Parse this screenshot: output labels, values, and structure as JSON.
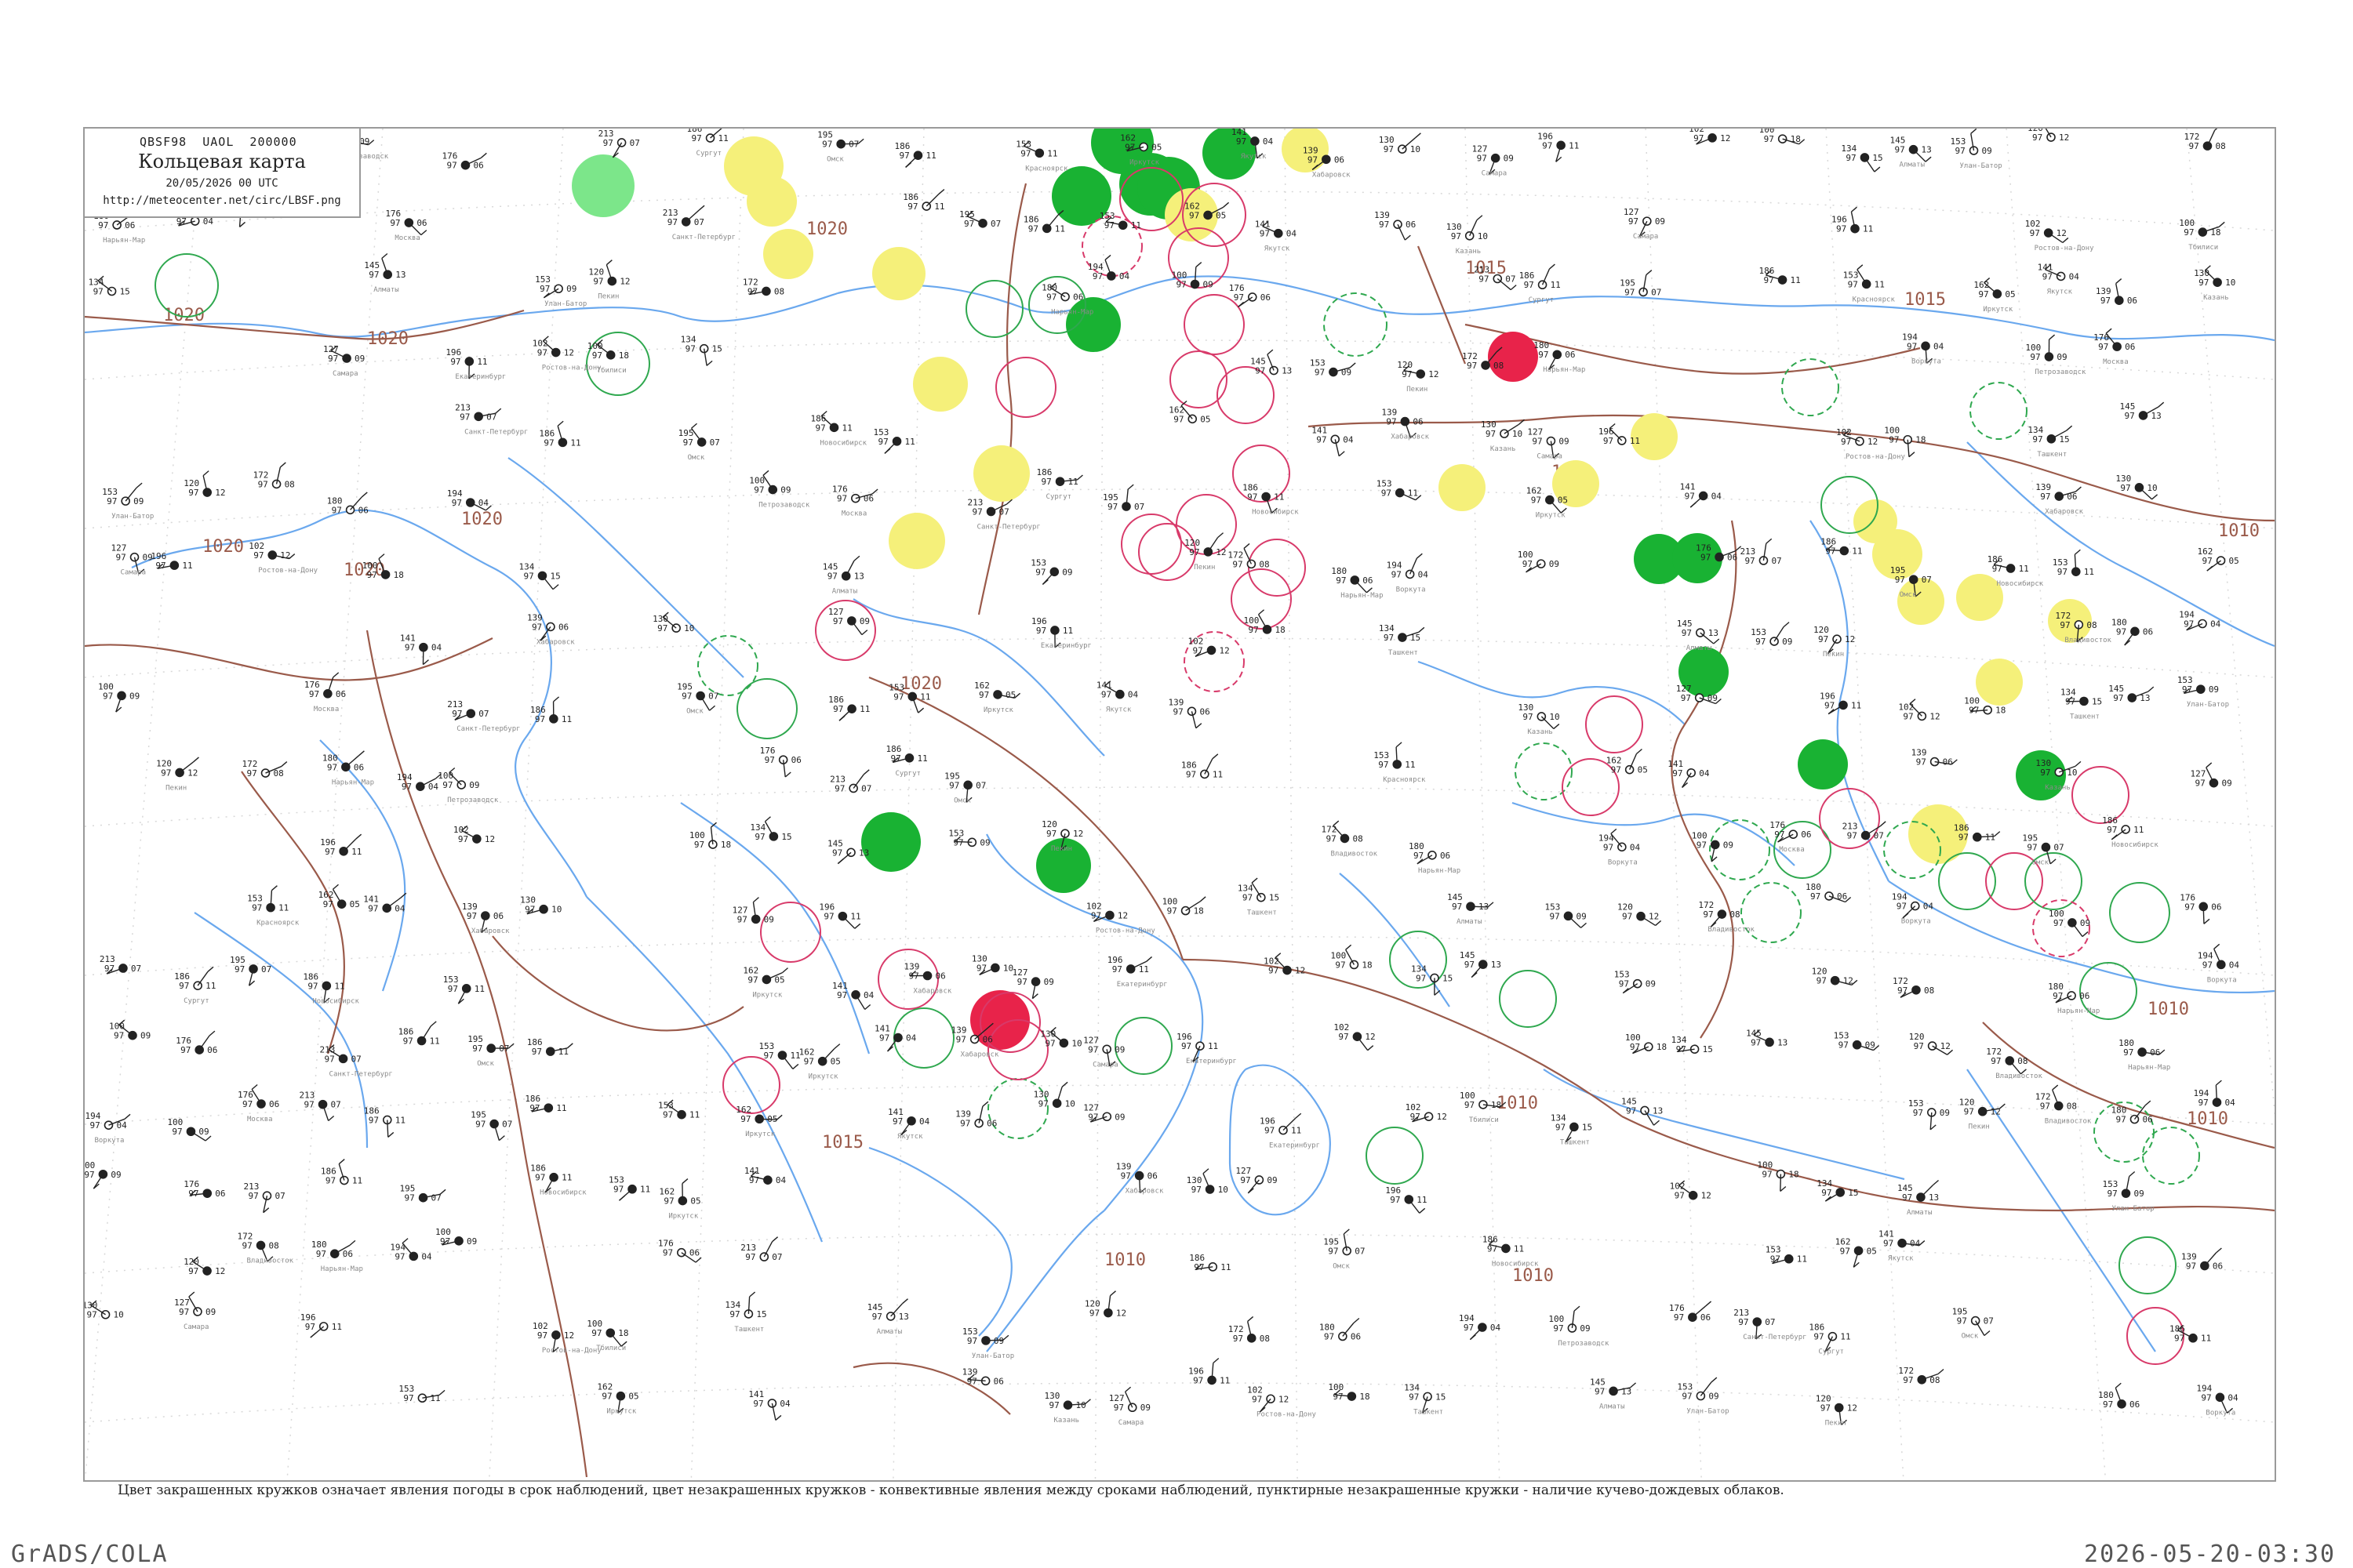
{
  "header": {
    "code": "QBSF98  UAOL  200000",
    "title": "Кольцевая карта",
    "date": "20/05/2026 00 UTC",
    "url": "http://meteocenter.net/circ/LBSF.png"
  },
  "caption": "Цвет закрашенных кружков означает явления погоды в срок наблюдений, цвет незакрашенных кружков - конвективные явления между сроками наблюдений, пунктирные незакрашенные кружки - наличие кучево-дождевых облаков.",
  "footer": {
    "left": "GrADS/COLA",
    "right": "2026-05-20-03:30"
  },
  "colors": {
    "coast": "#6aa8ee",
    "isobar": "#9a5a4a",
    "filled_green": "#19b233",
    "filled_yellow": "#f5f07a",
    "filled_light_green": "#7ce68a",
    "filled_red": "#e8234a",
    "ring_green": "#2fa84f",
    "ring_red": "#d83a6a",
    "station": "#222222"
  },
  "isobar_labels": [
    "1020",
    "1020",
    "1020",
    "1020",
    "1020",
    "1020",
    "1020",
    "1015",
    "1015",
    "1015",
    "1010",
    "1010",
    "1010",
    "1010",
    "1010",
    "1010",
    "1010"
  ],
  "stations": [
    {
      "name": "Нарьян-Мар",
      "t": "180",
      "p": "97",
      "d": "06"
    },
    {
      "name": "Воркута",
      "t": "194",
      "p": "97",
      "d": "04"
    },
    {
      "name": "Петрозаводск",
      "t": "100",
      "p": "97",
      "d": "09"
    },
    {
      "name": "Москва",
      "t": "176",
      "p": "97",
      "d": "06"
    },
    {
      "name": "Санкт-Петербург",
      "t": "213",
      "p": "97",
      "d": "07"
    },
    {
      "name": "Сургут",
      "t": "186",
      "p": "97",
      "d": "11"
    },
    {
      "name": "Омск",
      "t": "195",
      "p": "97",
      "d": "07"
    },
    {
      "name": "Новосибирск",
      "t": "186",
      "p": "97",
      "d": "11"
    },
    {
      "name": "Красноярск",
      "t": "153",
      "p": "97",
      "d": "11"
    },
    {
      "name": "Иркутск",
      "t": "162",
      "p": "97",
      "d": "05"
    },
    {
      "name": "Якутск",
      "t": "141",
      "p": "97",
      "d": "04"
    },
    {
      "name": "Хабаровск",
      "t": "139",
      "p": "97",
      "d": "06"
    },
    {
      "name": "Казань",
      "t": "130",
      "p": "97",
      "d": "10"
    },
    {
      "name": "Самара",
      "t": "127",
      "p": "97",
      "d": "09"
    },
    {
      "name": "Екатеринбург",
      "t": "196",
      "p": "97",
      "d": "11"
    },
    {
      "name": "Ростов-на-Дону",
      "t": "102",
      "p": "97",
      "d": "12"
    },
    {
      "name": "Тбилиси",
      "t": "100",
      "p": "97",
      "d": "18"
    },
    {
      "name": "Ташкент",
      "t": "134",
      "p": "97",
      "d": "15"
    },
    {
      "name": "Алматы",
      "t": "145",
      "p": "97",
      "d": "13"
    },
    {
      "name": "Улан-Батор",
      "t": "153",
      "p": "97",
      "d": "09"
    },
    {
      "name": "Пекин",
      "t": "120",
      "p": "97",
      "d": "12"
    },
    {
      "name": "Владивосток",
      "t": "172",
      "p": "97",
      "d": "08"
    }
  ]
}
